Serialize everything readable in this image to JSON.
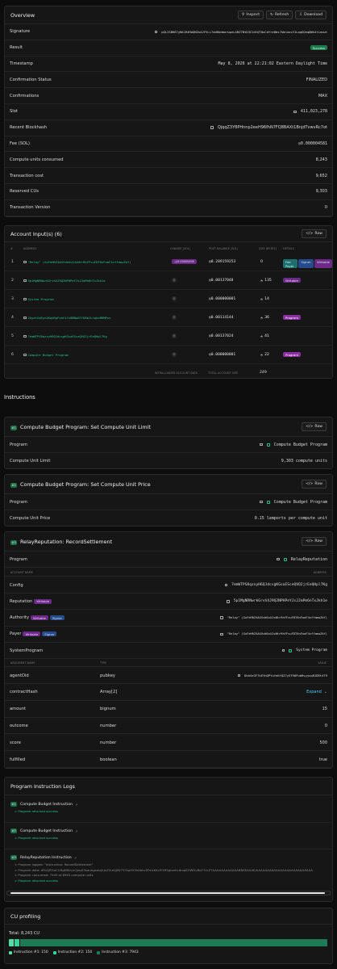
{
  "overview": {
    "title": "Overview",
    "buttons": {
      "inspect": "Inspect",
      "refresh": "Refresh",
      "download": "Download"
    },
    "rows": [
      {
        "label": "Signature",
        "value": "pQL2SBH67yNk1R4RbQNZuAJFSLL7dd6bdmarwpeu1BZ7BtD3C2dtQT8uCdfre8bs7kbnuuvV1LqqGQeqQWk4tLeuwt",
        "kind": "copy"
      },
      {
        "label": "Result",
        "value": "Success",
        "kind": "pill"
      },
      {
        "label": "Timestamp",
        "value": "May 8, 2026 at 22:21:02 Eastern Daylight Time",
        "kind": "mono"
      },
      {
        "label": "Confirmation Status",
        "value": "FINALIZED",
        "kind": "text"
      },
      {
        "label": "Confirmations",
        "value": "MAX",
        "kind": "text"
      },
      {
        "label": "Slot",
        "value": "411,023,278",
        "kind": "link"
      },
      {
        "label": "Recent Blockhash",
        "value": "QjqqZ3Y8PHnnp2eeH96fhN7FQ8BAXt1BnjdTvwvRc7ot",
        "kind": "text"
      },
      {
        "label": "Fee (SOL)",
        "value": "◎0.000004581",
        "kind": "mono"
      },
      {
        "label": "Compute units consumed",
        "value": "8,243",
        "kind": "text"
      },
      {
        "label": "Transaction cost",
        "value": "9,652",
        "kind": "text"
      },
      {
        "label": "Reserved CUs",
        "value": "9,303",
        "kind": "text"
      },
      {
        "label": "Transaction Version",
        "value": "0",
        "kind": "text"
      }
    ]
  },
  "accounts": {
    "title": "Account Input(s) (6)",
    "raw": "Raw",
    "headers": {
      "num": "#",
      "address": "ADDRESS",
      "change": "CHANGE (SOL)",
      "post": "POST BALANCE (SOL)",
      "size": "SIZE (BYTES)",
      "details": "DETAILS"
    },
    "rows": [
      {
        "n": "1",
        "address": "\"Relay\" (GxFeHRZ4AXVcW4vXJsNtrRhYFvuFDT6nFoaF4vffamwZkY)",
        "change": "-◎0.00000458",
        "post": "◎0.289159253",
        "size": "0",
        "tags": [
          "Fee Payer",
          "Signer",
          "Writable"
        ]
      },
      {
        "n": "2",
        "address": "5p1MgNRNwrkGrvhXJ9Q2NPHPeYJsJJmPm6nTxJkh1e",
        "change": "0",
        "post": "◎0.00137048",
        "size": "135",
        "tags": [
          "Writable"
        ]
      },
      {
        "n": "3",
        "address": "System Program",
        "change": "0",
        "post": "◎0.000000001",
        "size": "14",
        "tags": []
      },
      {
        "n": "4",
        "address": "2AyetXdEyn2KqkRgFoaY1fv8BNpDTfD8b1LtqbcBRMPsu",
        "change": "0",
        "post": "◎0.00114144",
        "size": "36",
        "tags": [
          "Program"
        ]
      },
      {
        "n": "5",
        "address": "7emWTPS8qzxyH6QJdcsgKGsaESceQVQ2jrEeQHpl7Kg",
        "change": "0",
        "post": "◎0.00137024",
        "size": "41",
        "tags": []
      },
      {
        "n": "6",
        "address": "Compute Budget Program",
        "change": "0",
        "post": "◎0.000000001",
        "size": "22",
        "tags": [
          "Program"
        ]
      }
    ],
    "footer": {
      "loaded": "INTRA-LOADED ACCOUNT DATA",
      "total_label": "TOTAL ACCOUNT SIZE",
      "total": "249"
    }
  },
  "instructions_heading": "Instructions",
  "ix1": {
    "num": "#1",
    "title": "Compute Budget Program: Set Compute Unit Limit",
    "raw": "Raw",
    "rows": [
      {
        "label": "Program",
        "value": "Compute Budget Program",
        "link": true
      },
      {
        "label": "Compute Unit Limit",
        "value": "9,303 compute units",
        "link": false
      }
    ]
  },
  "ix2": {
    "num": "#2",
    "title": "Compute Budget Program: Set Compute Unit Price",
    "raw": "Raw",
    "rows": [
      {
        "label": "Program",
        "value": "Compute Budget Program",
        "link": true
      },
      {
        "label": "Compute Unit Price",
        "value": "0.15 lamports per compute unit",
        "link": false
      }
    ]
  },
  "ix3": {
    "num": "#3",
    "title": "RelayReputation: RecordSettlement",
    "raw": "Raw",
    "program": {
      "label": "Program",
      "value": "RelayReputation"
    },
    "acct_headers": {
      "name": "ACCOUNT NAME",
      "address": "ADDRESS"
    },
    "accounts": [
      {
        "label": "Config",
        "tags": [],
        "value": "7emWTPS8qzxyH6QJdcsgKGsaESceQVQ2jrEeQHpl7Kg"
      },
      {
        "label": "Reputation",
        "tags": [
          "Writable"
        ],
        "value": "5p1MgNRNwrkGrvhXJ9Q2NPHPeYJsJJmPm6nTxJkh1e"
      },
      {
        "label": "Authority",
        "tags": [
          "Writable",
          "Signer"
        ],
        "value": "\"Relay\" (GxFeHRZ4AXVcW4vXJsNtrRhYFvuFDT6nFoaF4vffamwZkY)"
      },
      {
        "label": "Payer",
        "tags": [
          "Writable",
          "Signer"
        ],
        "value": "\"Relay\" (GxFeHRZ4AXVcW4vXJsNtrRhYFvuFDT6nFoaF4vffamwZkY)"
      },
      {
        "label": "SystemProgram",
        "tags": [],
        "value": "System Program"
      }
    ],
    "arg_headers": {
      "name": "ARGUMENT NAME",
      "type": "TYPE",
      "value": "VALUE"
    },
    "args": [
      {
        "name": "agentDid",
        "type": "pubkey",
        "value": "DkkSe3F7kEYhQPYuYeKfQZ7y5T96PubRvyyxqRJDRt4T9",
        "link": true
      },
      {
        "name": "contractHash",
        "type": "Array[2]",
        "value": "Expand",
        "link": false
      },
      {
        "name": "amount",
        "type": "bignum",
        "value": "15",
        "link": false
      },
      {
        "name": "outcome",
        "type": "number",
        "value": "0",
        "link": false
      },
      {
        "name": "score",
        "type": "number",
        "value": "500",
        "link": false
      },
      {
        "name": "fulfilled",
        "type": "boolean",
        "value": "true",
        "link": false
      }
    ]
  },
  "logs": {
    "title": "Program Instruction Logs",
    "groups": [
      {
        "num": "#1",
        "name": "Compute Budget Instruction",
        "lines": [
          "> Program returned success"
        ]
      },
      {
        "num": "#2",
        "name": "Compute Budget Instruction",
        "lines": [
          "> Program returned success"
        ]
      },
      {
        "num": "#3",
        "name": "RelayReputation Instruction",
        "lines": [
          "> Program logged: \"Instruction: RecordSettlement\"",
          "> Program data: dFb2jRGaC1MgM8irysCJeoX3eaungsaIxjkJuZ2reQJMJ737kpHX3ekbhcZFeIzKKcEOM5gtueksItmqEGWDvBqY7ccZ7AAAAAAAAAAAABBAEAAAE/AAAAAAAAAAAAAAAAAAAAAAAAAA",
          "> Program consumed: 7943 of 8983 compute units",
          "> Program returned success"
        ]
      }
    ]
  },
  "cu": {
    "title": "CU profiling",
    "total": "Total: 8,243 CU",
    "fraction": [
      150,
      150,
      7943
    ],
    "legend": [
      "Instruction #1: 150",
      "Instruction #2: 150",
      "Instruction #3: 7943"
    ],
    "colors": [
      "#4fe0a6",
      "#3ccf98",
      "#1e7a55"
    ]
  }
}
